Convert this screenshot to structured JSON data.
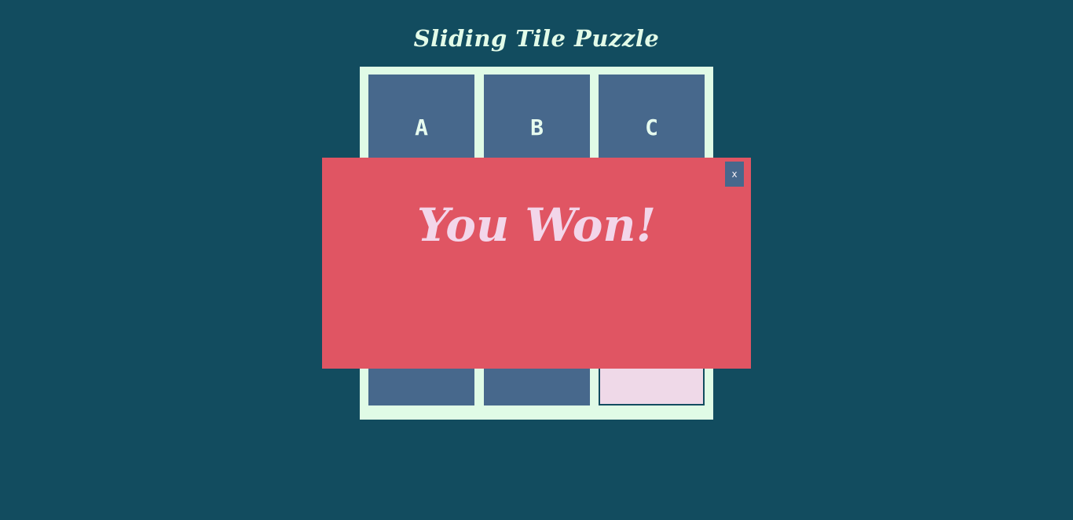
{
  "page": {
    "title": "Sliding Tile Puzzle"
  },
  "board": {
    "tiles": [
      {
        "label": "A"
      },
      {
        "label": "B"
      },
      {
        "label": "C"
      },
      {
        "label": ""
      },
      {
        "label": ""
      },
      {
        "label": ""
      },
      {
        "label": ""
      },
      {
        "label": ""
      },
      {
        "label": ""
      }
    ]
  },
  "modal": {
    "close_label": "x",
    "message": "You Won!"
  },
  "colors": {
    "background": "#124c5f",
    "board_frame": "#e0fbe6",
    "tile": "#47688c",
    "blank_tile": "#efd9e8",
    "modal_background": "#e05563",
    "modal_text": "#f3d6ea"
  }
}
